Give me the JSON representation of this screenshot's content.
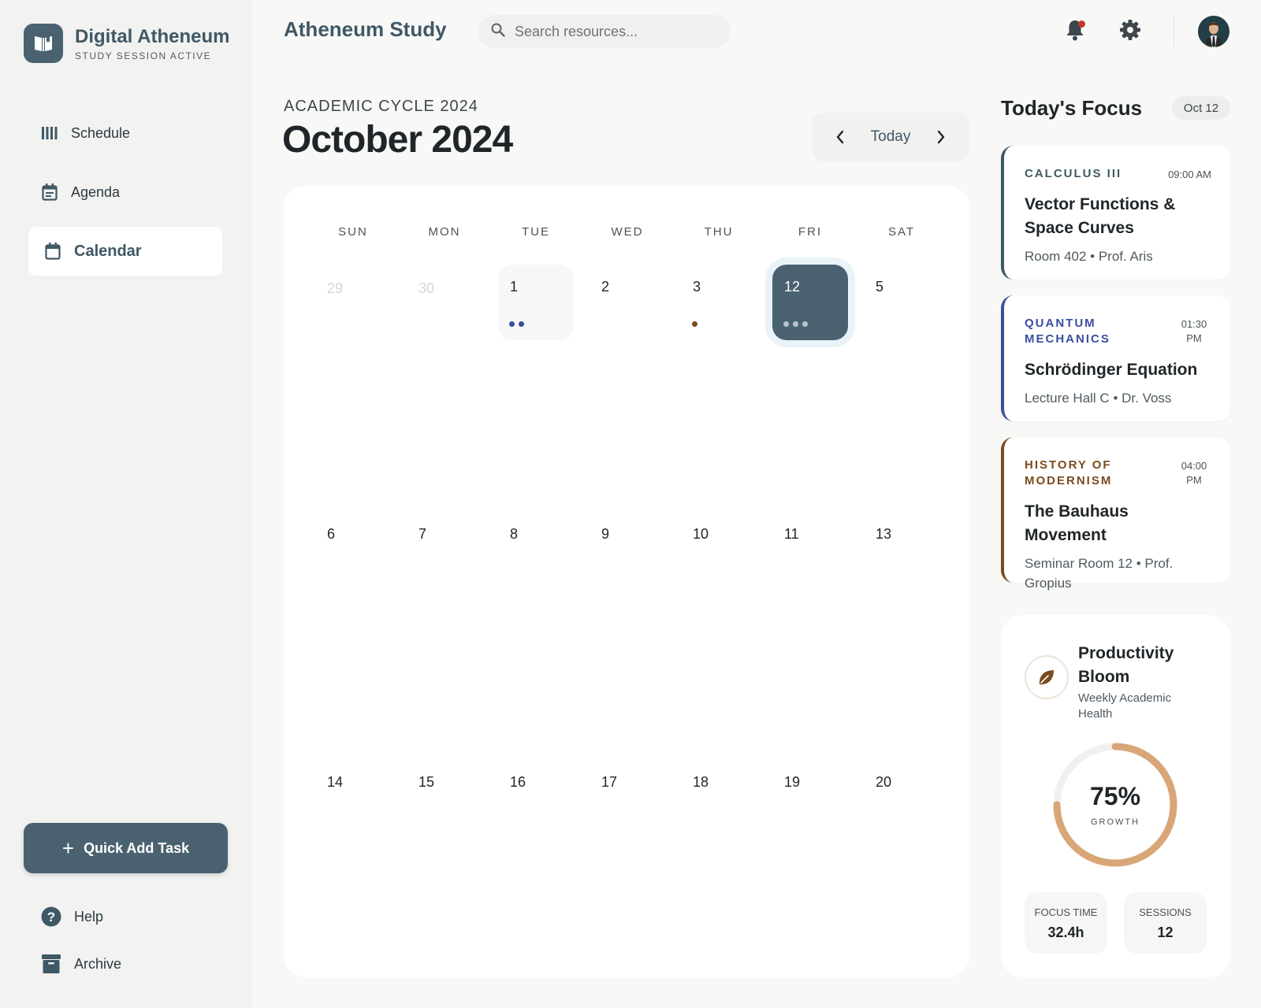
{
  "brand": {
    "title": "Digital Atheneum",
    "subtitle": "STUDY SESSION ACTIVE"
  },
  "nav": [
    {
      "label": "Schedule",
      "icon": "schedule-icon",
      "active": false
    },
    {
      "label": "Agenda",
      "icon": "agenda-icon",
      "active": false
    },
    {
      "label": "Calendar",
      "icon": "calendar-icon",
      "active": true
    }
  ],
  "quick_add_label": "Quick Add Task",
  "footer": {
    "help": "Help",
    "archive": "Archive"
  },
  "header": {
    "app_title": "Atheneum Study",
    "search_placeholder": "Search resources...",
    "notification_unread": true
  },
  "calendar": {
    "cycle": "ACADEMIC CYCLE 2024",
    "month": "October 2024",
    "today_label": "Today",
    "weekdays": [
      "SUN",
      "MON",
      "TUE",
      "WED",
      "THU",
      "FRI",
      "SAT"
    ],
    "weeks": [
      [
        "29",
        "30",
        "1",
        "2",
        "3",
        "12",
        "5"
      ],
      [
        "6",
        "7",
        "8",
        "9",
        "10",
        "11",
        "13"
      ],
      [
        "14",
        "15",
        "16",
        "17",
        "18",
        "19",
        "20"
      ]
    ],
    "selected_day": "12"
  },
  "focus": {
    "title": "Today's Focus",
    "date": "Oct 12",
    "events": [
      {
        "subject": "CALCULUS III",
        "time": "09:00 AM",
        "title": "Vector Functions & Space Curves",
        "location": "Room 402",
        "instructor": "Prof. Aris",
        "color": "#3f5866"
      },
      {
        "subject": "QUANTUM MECHANICS",
        "time": "01:30 PM",
        "title": "Schrödinger Equation",
        "location": "Lecture Hall C",
        "instructor": "Dr. Voss",
        "color": "#3a4ea0"
      },
      {
        "subject": "HISTORY OF MODERNISM",
        "time": "04:00 PM",
        "title": "The Bauhaus Movement",
        "location": "Seminar Room 12",
        "instructor": "Prof. Gropius",
        "color": "#7a4a1e"
      }
    ]
  },
  "productivity": {
    "title": "Productivity Bloom",
    "subtitle": "Weekly Academic Health",
    "percent": 75,
    "percent_label": "75%",
    "growth_label": "GROWTH",
    "focus_time_label": "FOCUS TIME",
    "focus_time": "32.4h",
    "sessions_label": "SESSIONS",
    "sessions": "12",
    "accent": "#d9a677"
  },
  "colors": {
    "primary": "#4a6270",
    "dot_blue": "#3a4ea0",
    "dot_brown": "#7a4a1e",
    "selected_ring": "#eaf3f8"
  }
}
